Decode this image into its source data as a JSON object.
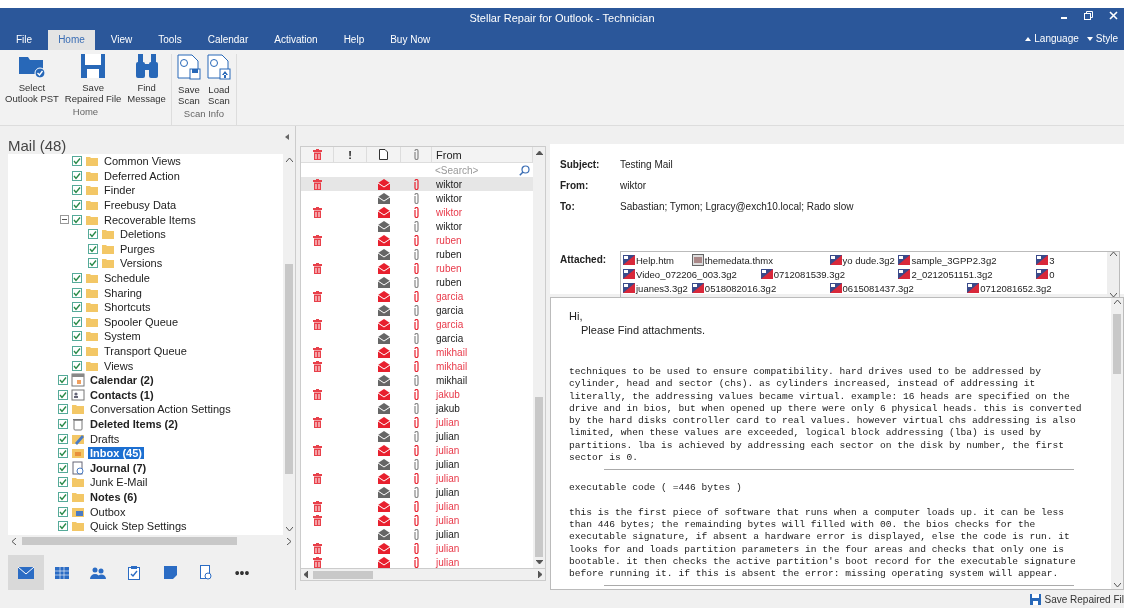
{
  "window": {
    "title": "Stellar Repair for Outlook - Technician"
  },
  "tabs": [
    {
      "label": "File",
      "selected": false
    },
    {
      "label": "Home",
      "selected": true
    },
    {
      "label": "View",
      "selected": false
    },
    {
      "label": "Tools",
      "selected": false
    },
    {
      "label": "Calendar",
      "selected": false
    },
    {
      "label": "Activation",
      "selected": false
    },
    {
      "label": "Help",
      "selected": false
    },
    {
      "label": "Buy Now",
      "selected": false
    }
  ],
  "tab_options": [
    "Language",
    "Style"
  ],
  "ribbon": {
    "groups": [
      {
        "label": "Home",
        "buttons": [
          {
            "kind": "folder",
            "label": "Select\nOutlook PST"
          },
          {
            "kind": "save",
            "label": "Save\nRepaired File"
          },
          {
            "kind": "find",
            "label": "Find\nMessage"
          }
        ]
      },
      {
        "label": "Scan Info",
        "buttons": [
          {
            "kind": "save_scan",
            "label": "Save\nScan"
          },
          {
            "kind": "load_scan",
            "label": "Load\nScan"
          }
        ]
      }
    ]
  },
  "sidebar": {
    "title": "Mail (48)",
    "tree": {
      "upper_folders": [
        {
          "label": "Common Views",
          "kind": "folder",
          "checked": true,
          "bold": false,
          "selected": false
        },
        {
          "label": "Deferred Action",
          "kind": "folder",
          "checked": true,
          "bold": false,
          "selected": false
        },
        {
          "label": "Finder",
          "kind": "folder",
          "checked": true,
          "bold": false,
          "selected": false
        },
        {
          "label": "Freebusy Data",
          "kind": "folder",
          "checked": true,
          "bold": false,
          "selected": false
        },
        {
          "label": "Recoverable Items",
          "kind": "folder",
          "checked": true,
          "bold": false,
          "selected": false,
          "expanded": true,
          "children": [
            {
              "label": "Deletions",
              "kind": "folder",
              "checked": true,
              "bold": false,
              "selected": false
            },
            {
              "label": "Purges",
              "kind": "folder",
              "checked": true,
              "bold": false,
              "selected": false
            },
            {
              "label": "Versions",
              "kind": "folder",
              "checked": true,
              "bold": false,
              "selected": false
            }
          ]
        },
        {
          "label": "Schedule",
          "kind": "folder",
          "checked": true,
          "bold": false,
          "selected": false
        },
        {
          "label": "Sharing",
          "kind": "folder",
          "checked": true,
          "bold": false,
          "selected": false
        },
        {
          "label": "Shortcuts",
          "kind": "folder",
          "checked": true,
          "bold": false,
          "selected": false
        },
        {
          "label": "Spooler Queue",
          "kind": "folder",
          "checked": true,
          "bold": false,
          "selected": false
        },
        {
          "label": "System",
          "kind": "folder",
          "checked": true,
          "bold": false,
          "selected": false
        },
        {
          "label": "Transport Queue",
          "kind": "folder",
          "checked": true,
          "bold": false,
          "selected": false
        },
        {
          "label": "Views",
          "kind": "folder",
          "checked": true,
          "bold": false,
          "selected": false
        }
      ],
      "folders": [
        {
          "label": "Calendar (2)",
          "kind": "calendar",
          "checked": true,
          "bold": true,
          "selected": false
        },
        {
          "label": "Contacts (1)",
          "kind": "contacts",
          "checked": true,
          "bold": true,
          "selected": false
        },
        {
          "label": "Conversation Action Settings",
          "kind": "folder",
          "checked": true,
          "bold": false,
          "selected": false
        },
        {
          "label": "Deleted Items (2)",
          "kind": "trash",
          "checked": true,
          "bold": true,
          "selected": false
        },
        {
          "label": "Drafts",
          "kind": "drafts",
          "checked": true,
          "bold": false,
          "selected": false
        },
        {
          "label": "Inbox (45)",
          "kind": "inbox",
          "checked": true,
          "bold": true,
          "selected": true
        },
        {
          "label": "Journal (7)",
          "kind": "journal",
          "checked": true,
          "bold": true,
          "selected": false
        },
        {
          "label": "Junk E-Mail",
          "kind": "folder",
          "checked": true,
          "bold": false,
          "selected": false
        },
        {
          "label": "Notes (6)",
          "kind": "folder",
          "checked": true,
          "bold": true,
          "selected": false
        },
        {
          "label": "Outbox",
          "kind": "outbox",
          "checked": true,
          "bold": false,
          "selected": false
        },
        {
          "label": "Quick Step Settings",
          "kind": "folder",
          "checked": true,
          "bold": false,
          "selected": false
        }
      ]
    },
    "nav": [
      {
        "kind": "mail",
        "selected": true
      },
      {
        "kind": "calendar",
        "selected": false
      },
      {
        "kind": "people",
        "selected": false
      },
      {
        "kind": "tasks",
        "selected": false
      },
      {
        "kind": "notes",
        "selected": false
      },
      {
        "kind": "journal",
        "selected": false
      },
      {
        "kind": "more",
        "label": "•••",
        "selected": false
      }
    ]
  },
  "message_list": {
    "columns": [
      {
        "kind": "deleted"
      },
      {
        "kind": "importance",
        "label": "!"
      },
      {
        "kind": "type"
      },
      {
        "kind": "attachment"
      },
      {
        "kind": "text",
        "label": "From"
      }
    ],
    "search": {
      "placeholder": "<Search>"
    },
    "rows": [
      {
        "from": "wiktor",
        "deleted": true,
        "selected": true
      },
      {
        "from": "wiktor",
        "deleted": false,
        "selected": false
      },
      {
        "from": "wiktor",
        "deleted": true,
        "selected": false
      },
      {
        "from": "wiktor",
        "deleted": false,
        "selected": false
      },
      {
        "from": "ruben",
        "deleted": true,
        "selected": false
      },
      {
        "from": "ruben",
        "deleted": false,
        "selected": false
      },
      {
        "from": "ruben",
        "deleted": true,
        "selected": false
      },
      {
        "from": "ruben",
        "deleted": false,
        "selected": false
      },
      {
        "from": "garcia",
        "deleted": true,
        "selected": false
      },
      {
        "from": "garcia",
        "deleted": false,
        "selected": false
      },
      {
        "from": "garcia",
        "deleted": true,
        "selected": false
      },
      {
        "from": "garcia",
        "deleted": false,
        "selected": false
      },
      {
        "from": "mikhail",
        "deleted": true,
        "selected": false
      },
      {
        "from": "mikhail",
        "deleted": true,
        "selected": false
      },
      {
        "from": "mikhail",
        "deleted": false,
        "selected": false
      },
      {
        "from": "jakub",
        "deleted": true,
        "selected": false
      },
      {
        "from": "jakub",
        "deleted": false,
        "selected": false
      },
      {
        "from": "julian",
        "deleted": true,
        "selected": false
      },
      {
        "from": "julian",
        "deleted": false,
        "selected": false
      },
      {
        "from": "julian",
        "deleted": true,
        "selected": false
      },
      {
        "from": "julian",
        "deleted": false,
        "selected": false
      },
      {
        "from": "julian",
        "deleted": true,
        "selected": false
      },
      {
        "from": "julian",
        "deleted": false,
        "selected": false
      },
      {
        "from": "julian",
        "deleted": true,
        "selected": false
      },
      {
        "from": "julian",
        "deleted": true,
        "selected": false
      },
      {
        "from": "julian",
        "deleted": false,
        "selected": false
      },
      {
        "from": "julian",
        "deleted": true,
        "selected": false
      },
      {
        "from": "julian",
        "deleted": true,
        "selected": false
      }
    ]
  },
  "reading_pane": {
    "fields": [
      {
        "label": "Subject:",
        "value": "Testing Mail"
      },
      {
        "label": "From:",
        "value": "wiktor"
      },
      {
        "label": "To:",
        "value": "Sabastian; Tymon; Lgracy@exch10.local; Rado slow"
      }
    ],
    "attachments_label": "Attached:",
    "attachments": [
      {
        "name": "Help.htm",
        "kind": "video"
      },
      {
        "name": "themedata.thmx",
        "kind": "theme"
      },
      {
        "name": "yo dude.3g2",
        "kind": "video"
      },
      {
        "name": "sample_3GPP2.3g2",
        "kind": "video"
      },
      {
        "name": "3",
        "kind": "video"
      },
      {
        "name": "Video_072206_003.3g2",
        "kind": "video"
      },
      {
        "name": "0712081539.3g2",
        "kind": "video"
      },
      {
        "name": "2_0212051151.3g2",
        "kind": "video"
      },
      {
        "name": "0",
        "kind": "video"
      },
      {
        "name": "juanes3.3g2",
        "kind": "video"
      },
      {
        "name": "0518082016.3g2",
        "kind": "video"
      },
      {
        "name": "0615081437.3g2",
        "kind": "video"
      },
      {
        "name": "0712081652.3g2",
        "kind": "video"
      }
    ],
    "greeting": [
      "Hi,",
      "Please Find attachments."
    ],
    "body": [
      {
        "kind": "text",
        "text": "techniques to be used to ensure compatibility. hard drives used to be addressed by cylinder, head and sector (chs). as cylinders increased, instead of addressing it literally, the addressing values became virtual. example: 16 heads are specified on the drive and in bios, but when opened up there were only 6 physical heads. this is converted by the hard disks controller card to real values. however virtual chs addressing is also limited, when these values are exceeded, logical block addressing (lba) is used by partitions. lba is achieved by addressing each sector on the disk by number, the first sector is 0."
      },
      {
        "kind": "rule"
      },
      {
        "kind": "text",
        "text": "executable code ( =446 bytes )"
      },
      {
        "kind": "text",
        "text": "this is the first piece of software that runs when a computer loads up. it can be less than 446 bytes; the remainding bytes will filled with 00. the bios checks for the executable signature, if absent a hardware error is displayed, else the code is run. it looks for and loads partition parameters in the four areas and checks that only one is bootable. it then checks the active partition's boot record for the executable signature before running it. if this is absent the error: missing operating system will appear."
      },
      {
        "kind": "rule"
      }
    ]
  },
  "status_bar": {
    "action": "Save Repaired Fil"
  }
}
